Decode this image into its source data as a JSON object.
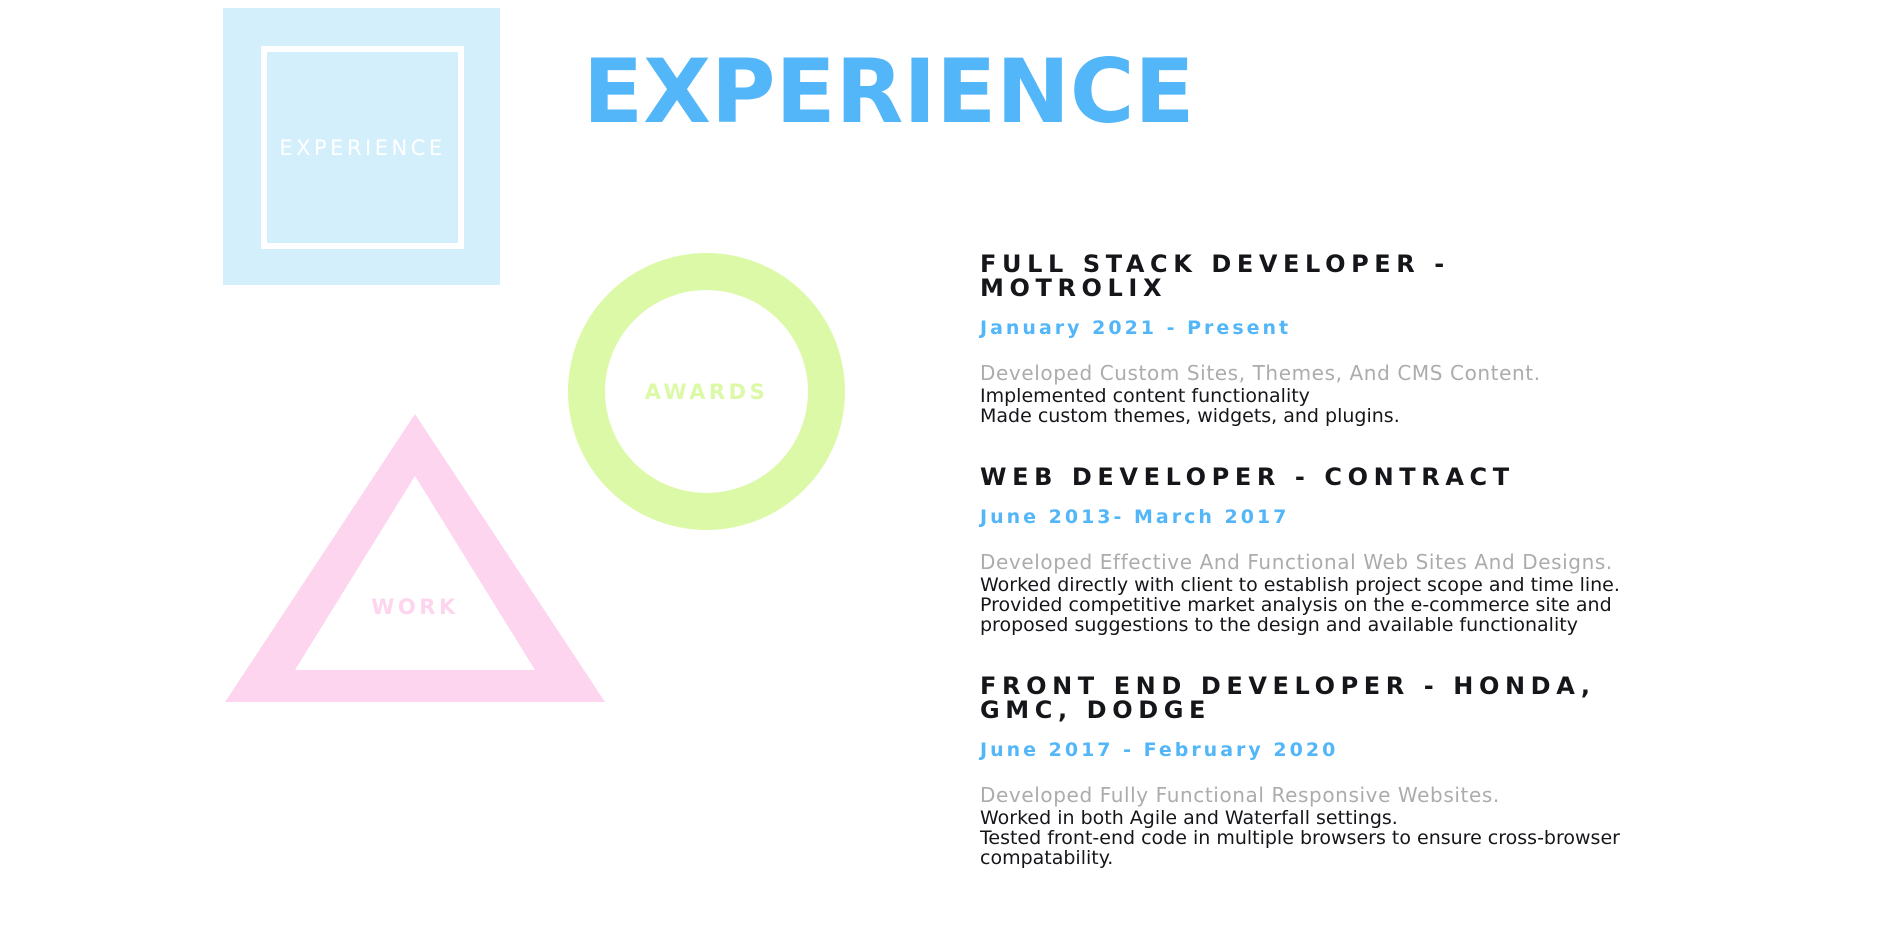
{
  "colors": {
    "accent_blue": "#53b6f9",
    "square_fill": "#d4effc",
    "circle_green": "#dcf9a8",
    "triangle_pink": "#fdd5ee",
    "heading_dark": "#15161a",
    "summary_gray": "#acacac"
  },
  "nav": {
    "square_label": "EXPERIENCE",
    "circle_label": "AWARDS",
    "triangle_label": "WORK"
  },
  "title": "EXPERIENCE",
  "jobs": [
    {
      "title": "FULL STACK DEVELOPER - MOTROLIX",
      "dates": "January 2021 - Present",
      "summary": "Developed Custom Sites, Themes, And CMS Content.",
      "bullets": [
        "Implemented content functionality",
        "Made custom themes, widgets, and plugins."
      ]
    },
    {
      "title": "WEB DEVELOPER - CONTRACT",
      "dates": "June 2013- March 2017",
      "summary": "Developed Effective And Functional Web Sites And Designs.",
      "bullets": [
        "Worked directly with client to establish project scope and time line.",
        "Provided competitive market analysis on the e-commerce site and proposed suggestions to the design and available functionality"
      ]
    },
    {
      "title": "FRONT END DEVELOPER - HONDA, GMC, DODGE",
      "dates": "June 2017 - February 2020",
      "summary": "Developed Fully Functional Responsive Websites.",
      "bullets": [
        "Worked in both Agile and Waterfall settings.",
        "Tested front-end code in multiple browsers to ensure cross-browser compatability."
      ]
    }
  ]
}
